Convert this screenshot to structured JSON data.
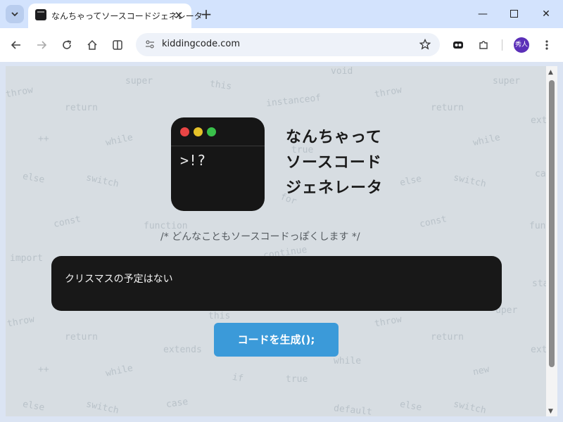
{
  "browser": {
    "tab_title": "なんちゃってソースコードジェネレータ",
    "url": "kiddingcode.com",
    "profile_initials": "秀人",
    "icons": [
      "tab-search-icon",
      "close-icon",
      "plus-icon",
      "minimize-icon",
      "maximize-icon",
      "back-icon",
      "forward-icon",
      "reload-icon",
      "home-icon",
      "split-view-icon",
      "site-settings-icon",
      "star-icon",
      "extension-icon",
      "puzzle-icon",
      "menu-icon"
    ]
  },
  "page": {
    "logo_text": ">!?",
    "title_lines": [
      "なんちゃって",
      "ソースコード",
      "ジェネレータ"
    ],
    "tagline": "/* どんなこともソースコードっぽくします */",
    "input_value": "クリスマスの予定はない",
    "generate_label": "コードを生成();",
    "colors": {
      "accent": "#3b9ad9",
      "dark": "#181818",
      "background": "#d7dde2"
    },
    "background_words": [
      "super",
      "void",
      "super",
      "throw",
      "this",
      "instanceof",
      "throw",
      "return",
      "return",
      "ext",
      "++",
      "while",
      "while",
      "else",
      "switch",
      "else",
      "switch",
      "ca",
      "const",
      "function",
      "const",
      "functio",
      "import",
      "continue",
      "sta",
      "throw",
      "this",
      "throw",
      "uper",
      "return",
      "return",
      "extends",
      "ext",
      "++",
      "while",
      "while",
      "new",
      "if",
      "true",
      "else",
      "switch",
      "case",
      "default",
      "else",
      "switch",
      "for",
      "true"
    ]
  }
}
